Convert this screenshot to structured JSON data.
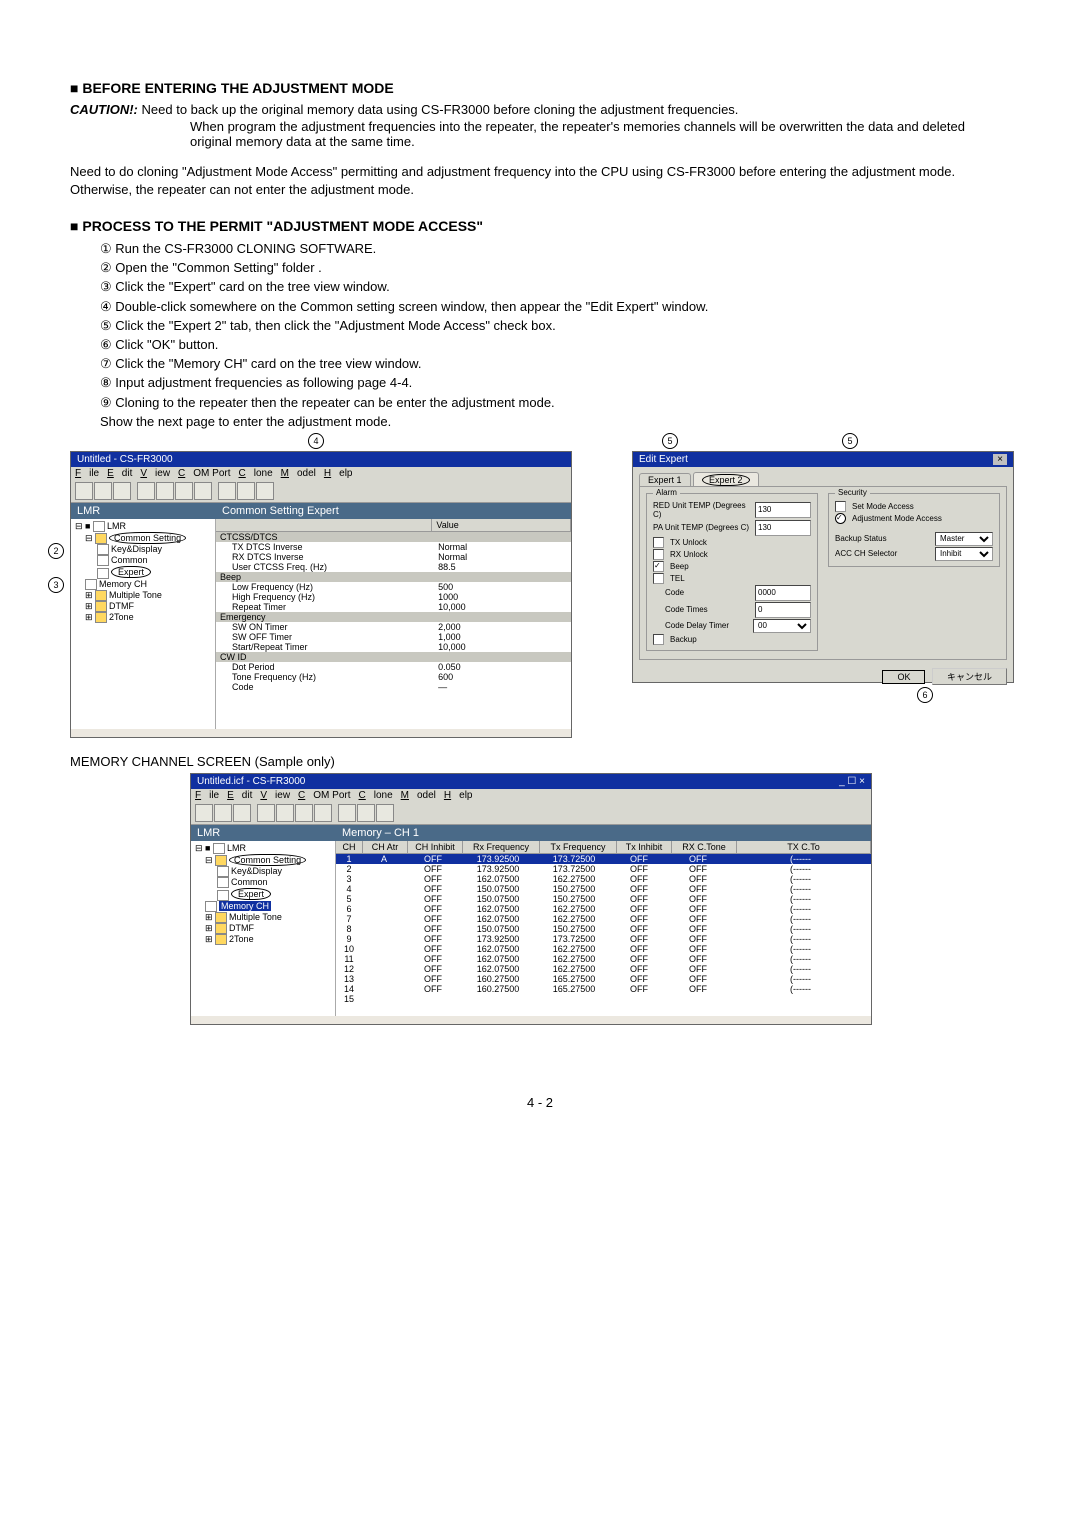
{
  "section1": "BEFORE ENTERING THE ADJUSTMENT MODE",
  "caution_label": "CAUTION!:",
  "caution_text1": "Need to back up the original memory data using CS-FR3000 before cloning the adjustment frequencies.",
  "caution_text2": "When program the adjustment frequencies into the repeater, the repeater's memories channels will be overwritten the data and deleted original memory data at the same time.",
  "para2": "Need to do cloning \"Adjustment Mode Access\" permitting and adjustment frequency into the CPU using CS-FR3000 before entering the adjustment mode. Otherwise, the repeater can not enter the adjustment mode.",
  "section2": "PROCESS TO THE PERMIT \"ADJUSTMENT MODE ACCESS\"",
  "steps": [
    "① Run the CS-FR3000 CLONING SOFTWARE.",
    "② Open the \"Common Setting\" folder .",
    "③ Click the \"Expert\" card on the tree view window.",
    "④ Double-click somewhere on the Common setting screen window, then appear the \"Edit Expert\" window.",
    "⑤ Click the \"Expert 2\" tab, then click the \"Adjustment Mode Access\" check box.",
    "⑥ Click \"OK\" button.",
    "⑦ Click the \"Memory CH\" card on the tree view window.",
    "⑧ Input adjustment frequencies as following page 4-4.",
    "⑨ Cloning to the repeater then the repeater can be enter the adjustment mode.",
    "    Show the next page to enter the adjustment mode."
  ],
  "shot1": {
    "title": "Untitled - CS-FR3000",
    "menus": [
      "File",
      "Edit",
      "View",
      "COM Port",
      "Clone",
      "Model",
      "Help"
    ],
    "banner_left": "LMR",
    "banner_right": "Common Setting Expert",
    "tree": [
      "LMR",
      "Common Setting",
      "Key&Display",
      "Common",
      "Expert",
      "Memory CH",
      "Multiple Tone",
      "DTMF",
      "2Tone"
    ],
    "grid_headers": [
      "",
      "Value"
    ],
    "groups": [
      {
        "name": "CTCSS/DTCS",
        "rows": [
          [
            "TX DTCS Inverse",
            "Normal"
          ],
          [
            "RX DTCS Inverse",
            "Normal"
          ],
          [
            "User CTCSS Freq. (Hz)",
            "88.5"
          ]
        ]
      },
      {
        "name": "Beep",
        "rows": [
          [
            "Low Frequency (Hz)",
            "500"
          ],
          [
            "High Frequency (Hz)",
            "1000"
          ],
          [
            "Repeat Timer",
            "10,000"
          ]
        ]
      },
      {
        "name": "Emergency",
        "rows": [
          [
            "SW ON Timer",
            "2,000"
          ],
          [
            "SW OFF Timer",
            "1,000"
          ],
          [
            "Start/Repeat Timer",
            "10,000"
          ]
        ]
      },
      {
        "name": "CW ID",
        "rows": [
          [
            "Dot Period",
            "0.050"
          ],
          [
            "Tone Frequency (Hz)",
            "600"
          ],
          [
            "Code",
            "—"
          ]
        ]
      }
    ]
  },
  "shot2": {
    "title": "Edit Expert",
    "tab1": "Expert 1",
    "tab2": "Expert 2",
    "alarm_title": "Alarm",
    "alarm_fields": [
      "RED Unit TEMP (Degrees C)",
      "PA Unit TEMP (Degrees C)"
    ],
    "alarm_value": "130",
    "alarm_checks": [
      "TX Unlock",
      "RX Unlock",
      "Beep",
      "TEL"
    ],
    "alarm_code_fields": [
      [
        "Code",
        "0000"
      ],
      [
        "Code Times",
        "0"
      ],
      [
        "Code Delay Timer",
        "00"
      ]
    ],
    "backup_check": "Backup",
    "security_title": "Security",
    "security_checks": [
      "Set Mode Access",
      "Adjustment Mode Access"
    ],
    "backup_status_label": "Backup Status",
    "backup_status_value": "Master",
    "acc_ch_label": "ACC CH Selector",
    "acc_ch_value": "Inhibit",
    "ok": "OK",
    "cancel": "キャンセル"
  },
  "mem_caption": "MEMORY CHANNEL SCREEN (Sample only)",
  "shot3": {
    "title": "Untitled.icf - CS-FR3000",
    "menus": [
      "File",
      "Edit",
      "View",
      "COM Port",
      "Clone",
      "Model",
      "Help"
    ],
    "banner_left": "LMR",
    "banner_right": "Memory – CH 1",
    "tree": [
      "LMR",
      "Common Setting",
      "Key&Display",
      "Common",
      "Expert",
      "Memory CH",
      "Multiple Tone",
      "DTMF",
      "2Tone"
    ],
    "headers": [
      "CH",
      "CH Atr",
      "CH Inhibit",
      "Rx Frequency",
      "Tx Frequency",
      "Tx Inhibit",
      "RX C.Tone",
      "TX C.To"
    ],
    "rows": [
      [
        "1",
        "A",
        "OFF",
        "173.92500",
        "173.72500",
        "OFF",
        "OFF",
        "(------"
      ],
      [
        "2",
        "",
        "OFF",
        "173.92500",
        "173.72500",
        "OFF",
        "OFF",
        "(------"
      ],
      [
        "3",
        "",
        "OFF",
        "162.07500",
        "162.27500",
        "OFF",
        "OFF",
        "(------"
      ],
      [
        "4",
        "",
        "OFF",
        "150.07500",
        "150.27500",
        "OFF",
        "OFF",
        "(------"
      ],
      [
        "5",
        "",
        "OFF",
        "150.07500",
        "150.27500",
        "OFF",
        "OFF",
        "(------"
      ],
      [
        "6",
        "",
        "OFF",
        "162.07500",
        "162.27500",
        "OFF",
        "OFF",
        "(------"
      ],
      [
        "7",
        "",
        "OFF",
        "162.07500",
        "162.27500",
        "OFF",
        "OFF",
        "(------"
      ],
      [
        "8",
        "",
        "OFF",
        "150.07500",
        "150.27500",
        "OFF",
        "OFF",
        "(------"
      ],
      [
        "9",
        "",
        "OFF",
        "173.92500",
        "173.72500",
        "OFF",
        "OFF",
        "(------"
      ],
      [
        "10",
        "",
        "OFF",
        "162.07500",
        "162.27500",
        "OFF",
        "OFF",
        "(------"
      ],
      [
        "11",
        "",
        "OFF",
        "162.07500",
        "162.27500",
        "OFF",
        "OFF",
        "(------"
      ],
      [
        "12",
        "",
        "OFF",
        "162.07500",
        "162.27500",
        "OFF",
        "OFF",
        "(------"
      ],
      [
        "13",
        "",
        "OFF",
        "160.27500",
        "165.27500",
        "OFF",
        "OFF",
        "(------"
      ],
      [
        "14",
        "",
        "OFF",
        "160.27500",
        "165.27500",
        "OFF",
        "OFF",
        "(------"
      ],
      [
        "15",
        "",
        "",
        "",
        "",
        "",
        "",
        ""
      ]
    ]
  },
  "page_num": "4 - 2"
}
